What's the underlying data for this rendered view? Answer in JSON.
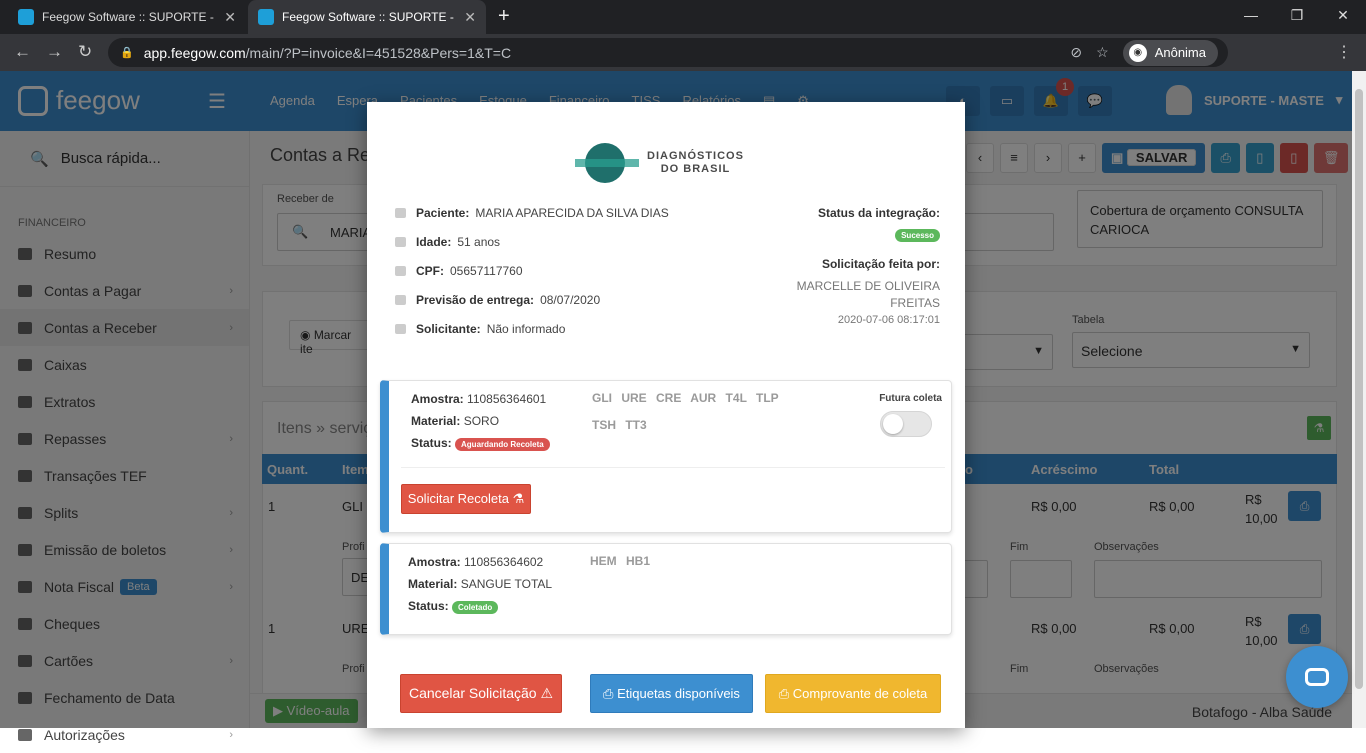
{
  "browser": {
    "tabs": [
      {
        "title": "Feegow Software :: SUPORTE - M",
        "active": false
      },
      {
        "title": "Feegow Software :: SUPORTE - M",
        "active": true
      }
    ],
    "url_host": "app.feegow.com",
    "url_path": "/main/?P=invoice&I=451528&Pers=1&T=C",
    "incognito_label": "Anônima"
  },
  "app": {
    "brand": "feegow",
    "menu": [
      "Agenda",
      "Espera",
      "Pacientes",
      "Estoque",
      "Financeiro",
      "TISS",
      "Relatórios"
    ],
    "notification_count": "1",
    "user": "SUPORTE - MASTE",
    "search_label": "Busca rápida...",
    "sidebar_section": "FINANCEIRO",
    "sidebar_items": [
      {
        "label": "Resumo",
        "chevron": false
      },
      {
        "label": "Contas a Pagar",
        "chevron": true
      },
      {
        "label": "Contas a Receber",
        "chevron": true
      },
      {
        "label": "Caixas",
        "chevron": false
      },
      {
        "label": "Extratos",
        "chevron": false
      },
      {
        "label": "Repasses",
        "chevron": true
      },
      {
        "label": "Transações TEF",
        "chevron": false
      },
      {
        "label": "Splits",
        "chevron": true
      },
      {
        "label": "Emissão de boletos",
        "chevron": true
      },
      {
        "label": "Nota Fiscal",
        "chevron": true,
        "badge": "Beta"
      },
      {
        "label": "Cheques",
        "chevron": false
      },
      {
        "label": "Cartões",
        "chevron": true
      },
      {
        "label": "Fechamento de Data",
        "chevron": false
      },
      {
        "label": "Autorizações",
        "chevron": true
      }
    ],
    "page_title": "Contas a Re",
    "save_label": "SALVAR",
    "receber_de_label": "Receber de",
    "receber_de_value": "MARIA",
    "coverage_text": "Cobertura de orçamento CONSULTA CARIOCA",
    "marcar_label": "Marcar ite",
    "tabela_label": "Tabela",
    "tabela_value": "Selecione",
    "itens_label": "Itens » serviço",
    "table_headers": {
      "quant": "Quant.",
      "item": "Item",
      "o": "o",
      "acrescimo": "Acréscimo",
      "total": "Total"
    },
    "rows": [
      {
        "quant": "1",
        "item": "GLI",
        "acrescimo": "R$ 0,00",
        "total": "R$ 0,00",
        "total2": "R$ 10,00"
      },
      {
        "quant": "1",
        "item": "URE",
        "acrescimo": "R$ 0,00",
        "total": "R$ 0,00",
        "total2": "R$ 10,00"
      }
    ],
    "subrow_labels": {
      "profi": "Profi",
      "fim": "Fim",
      "obs": "Observações",
      "de": "DE"
    },
    "video_label": "Vídeo-aula",
    "location": "Botafogo - Alba Saúde"
  },
  "modal": {
    "logo_line1": "DIAGNÓSTICOS",
    "logo_line2": "DO BRASIL",
    "paciente_label": "Paciente:",
    "paciente_value": "MARIA APARECIDA DA SILVA DIAS",
    "idade_label": "Idade:",
    "idade_value": "51 anos",
    "cpf_label": "CPF:",
    "cpf_value": "05657117760",
    "previsao_label": "Previsão de entrega:",
    "previsao_value": "08/07/2020",
    "solicitante_label": "Solicitante:",
    "solicitante_value": "Não informado",
    "status_integracao_label": "Status da integração:",
    "status_integracao_value": "Sucesso",
    "solicitacao_por_label": "Solicitação feita por:",
    "solicitacao_por_line1": "MARCELLE DE OLIVEIRA",
    "solicitacao_por_line2": "FREITAS",
    "solicitacao_datetime": "2020-07-06 08:17:01",
    "samples": [
      {
        "amostra_label": "Amostra:",
        "amostra": "110856364601",
        "material_label": "Material:",
        "material": "SORO",
        "status_label": "Status:",
        "status": "Aguardando Recoleta",
        "exams_line1": "GLI URE CRE AUR T4L TLP",
        "exams_line2": "TSH TT3",
        "futura_coleta_label": "Futura coleta",
        "button": "Solicitar Recoleta"
      },
      {
        "amostra_label": "Amostra:",
        "amostra": "110856364602",
        "material_label": "Material:",
        "material": "SANGUE TOTAL",
        "status_label": "Status:",
        "status": "Coletado",
        "exams_line1": "HEM HB1"
      }
    ],
    "cancel_button": "Cancelar Solicitação",
    "labels_button": "Etiquetas disponíveis",
    "receipt_button": "Comprovante de coleta"
  },
  "colors": {
    "primary": "#3d8fd0",
    "danger": "#e05544",
    "warning": "#f0b72f",
    "success": "#5cb85c"
  }
}
